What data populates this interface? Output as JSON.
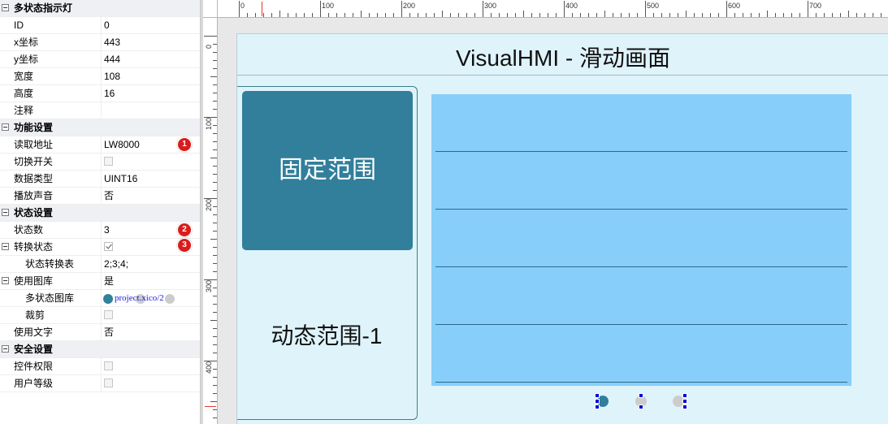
{
  "properties": {
    "sections": [
      {
        "title": "多状态指示灯",
        "rows": [
          {
            "label": "ID",
            "value": "0"
          },
          {
            "label": "x坐标",
            "value": "443"
          },
          {
            "label": "y坐标",
            "value": "444"
          },
          {
            "label": "宽度",
            "value": "108"
          },
          {
            "label": "高度",
            "value": "16"
          },
          {
            "label": "注释",
            "value": ""
          }
        ]
      },
      {
        "title": "功能设置",
        "rows": [
          {
            "label": "读取地址",
            "value": "LW8000",
            "badge": "1"
          },
          {
            "label": "切换开关",
            "value": "",
            "checkbox": false
          },
          {
            "label": "数据类型",
            "value": "UINT16"
          },
          {
            "label": "播放声音",
            "value": "否"
          }
        ]
      },
      {
        "title": "状态设置",
        "rows": [
          {
            "label": "状态数",
            "value": "3",
            "badge": "2"
          },
          {
            "label": "转换状态",
            "checkbox": true,
            "badge": "3"
          },
          {
            "label": "状态转换表",
            "value": "2;3;4;"
          },
          {
            "label": "使用图库",
            "value": "是"
          },
          {
            "label": "多状态图库",
            "value": "project.xico/2"
          },
          {
            "label": "裁剪",
            "checkbox": false
          },
          {
            "label": "使用文字",
            "value": "否"
          }
        ]
      },
      {
        "title": "安全设置",
        "rows": [
          {
            "label": "控件权限",
            "checkbox": false
          },
          {
            "label": "用户等级",
            "checkbox": false
          }
        ]
      }
    ]
  },
  "ruler": {
    "top_labels": [
      "0",
      "100",
      "200",
      "300",
      "400",
      "500",
      "600",
      "700"
    ],
    "left_labels": [
      "0",
      "100",
      "200",
      "300",
      "400"
    ]
  },
  "canvas": {
    "title": "VisualHMI - 滑动画面",
    "fixed_area_label": "固定范围",
    "dynamic_area_label": "动态范围-1"
  },
  "colors": {
    "page_bg": "#dff3fb",
    "fixed_panel": "#317f9b",
    "list_bg": "#87cefa",
    "badge": "#d91c1c",
    "selection_handle": "#0000d4"
  }
}
